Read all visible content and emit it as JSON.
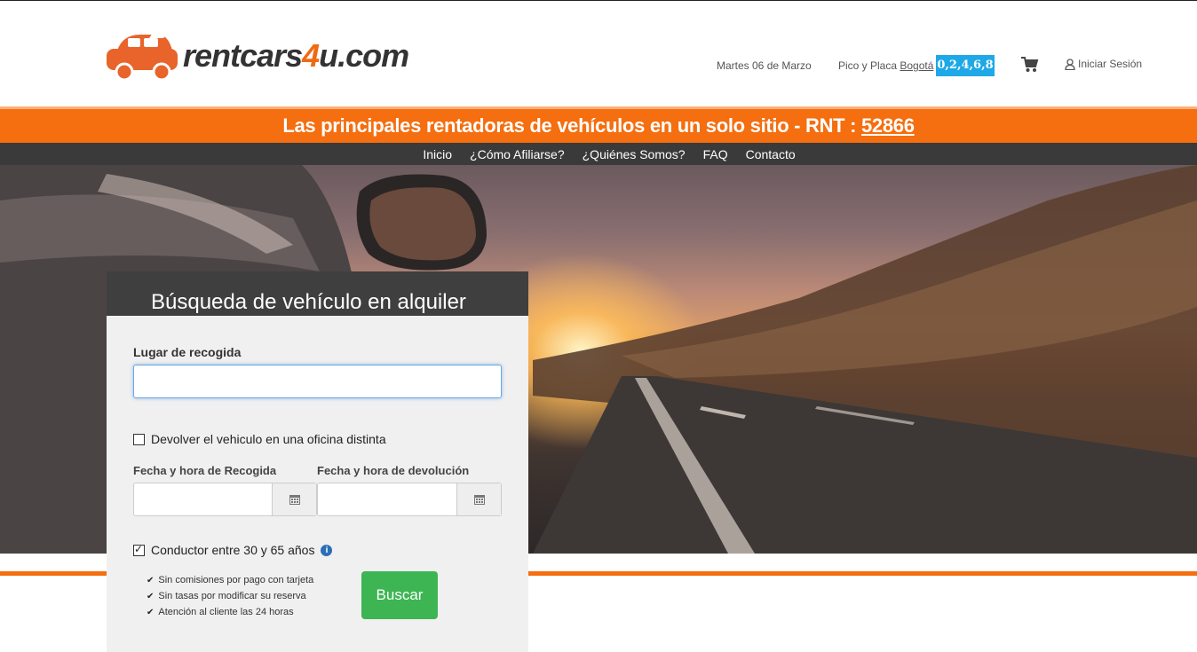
{
  "header": {
    "logo_text_prefix": "rentcars",
    "logo_text_four": "4",
    "logo_text_suffix": "u.com",
    "date": "Martes 06 de Marzo",
    "pico_label": "Pico y Placa",
    "pico_city": "Bogotá",
    "plates": "0,2,4,6,8",
    "login": "Iniciar Sesión",
    "cart_icon": "shopping-cart-icon",
    "user_icon": "user-icon"
  },
  "banner": {
    "text": "Las principales rentadoras de vehículos en un solo sitio - RNT : ",
    "rnt": "52866"
  },
  "nav": {
    "items": [
      "Inicio",
      "¿Cómo Afiliarse?",
      "¿Quiénes Somos?",
      "FAQ",
      "Contacto"
    ]
  },
  "search": {
    "title": "Búsqueda de vehículo en alquiler",
    "pickup_label": "Lugar de recogida",
    "pickup_value": "",
    "return_other_office": "Devolver el vehiculo en una oficina distinta",
    "return_other_office_checked": false,
    "pickup_date_label": "Fecha y hora de Recogida",
    "return_date_label": "Fecha y hora de devolución",
    "driver_age": "Conductor entre 30 y 65 años",
    "driver_age_checked": true,
    "features": [
      "Sin comisiones por pago con tarjeta",
      "Sin tasas por modificar su reserva",
      "Atención al cliente las 24 horas"
    ],
    "submit": "Buscar"
  },
  "colors": {
    "brand_orange": "#f56e0f",
    "plates_blue": "#1ea8e8",
    "button_green": "#3db553",
    "nav_dark": "#3a3a3a"
  }
}
